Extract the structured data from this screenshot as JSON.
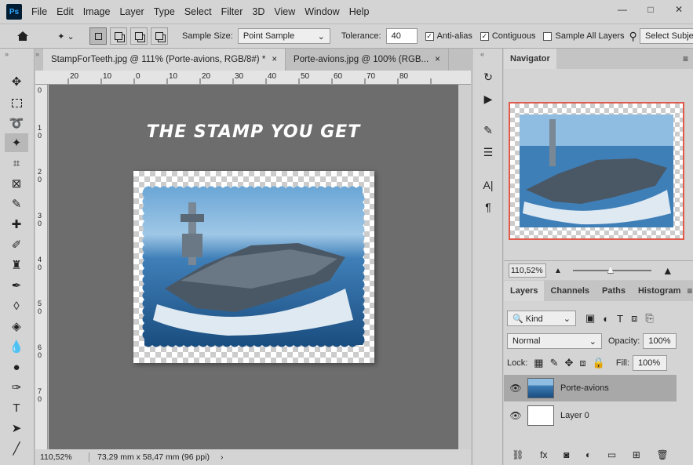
{
  "app": {
    "logo": "Ps"
  },
  "menu": [
    "File",
    "Edit",
    "Image",
    "Layer",
    "Type",
    "Select",
    "Filter",
    "3D",
    "View",
    "Window",
    "Help"
  ],
  "window_controls": {
    "minimize": "—",
    "restore": "□",
    "close": "✕"
  },
  "options": {
    "sample_size_label": "Sample Size:",
    "sample_size_value": "Point Sample",
    "tolerance_label": "Tolerance:",
    "tolerance_value": "40",
    "anti_alias_label": "Anti-alias",
    "contiguous_label": "Contiguous",
    "sample_all_layers_label": "Sample All Layers",
    "select_subject_label": "Select Subjec"
  },
  "tabs": [
    {
      "label": "StampForTeeth.jpg @ 111% (Porte-avions, RGB/8#) *",
      "close": "×"
    },
    {
      "label": "Porte-avions.jpg @ 100% (RGB...",
      "close": "×"
    }
  ],
  "ruler_h": [
    "20",
    "10",
    "0",
    "10",
    "20",
    "30",
    "40",
    "50",
    "60",
    "70",
    "80"
  ],
  "ruler_v": [
    "0",
    "1\n0",
    "2\n0",
    "3\n0",
    "4\n0",
    "5\n0",
    "6\n0",
    "7\n0"
  ],
  "canvas": {
    "title": "THE STAMP YOU GET"
  },
  "status": {
    "zoom": "110,52%",
    "doc_info": "73,29 mm x 58,47 mm (96 ppi)",
    "arrow": "›"
  },
  "navigator": {
    "tab": "Navigator",
    "zoom": "110,52%"
  },
  "layers_panel": {
    "tabs": [
      "Layers",
      "Channels",
      "Paths",
      "Histogram"
    ],
    "filter_kind": "Kind",
    "blend_mode": "Normal",
    "opacity_label": "Opacity:",
    "opacity_value": "100%",
    "lock_label": "Lock:",
    "fill_label": "Fill:",
    "fill_value": "100%",
    "layers": [
      {
        "name": "Porte-avions",
        "selected": true
      },
      {
        "name": "Layer 0",
        "selected": false
      }
    ]
  },
  "colors": {
    "accent_red": "#e05a4b",
    "bg": "#d4d4d4",
    "canvas_bg": "#6d6d6d"
  }
}
